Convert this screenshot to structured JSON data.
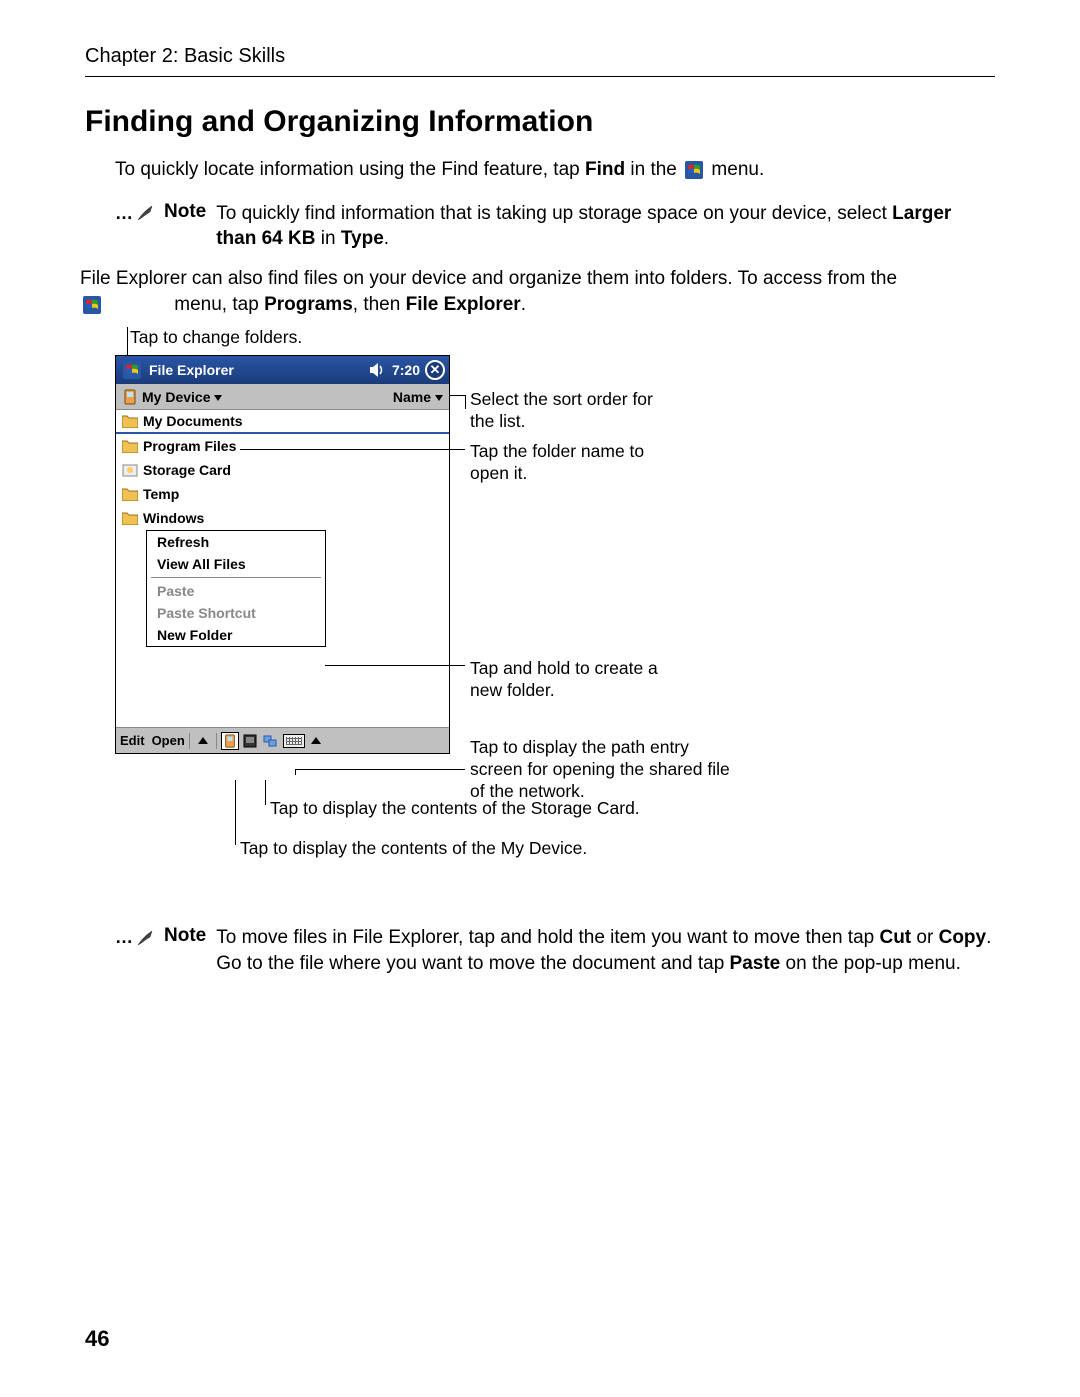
{
  "header": {
    "chapter": "Chapter 2: Basic Skills"
  },
  "title": "Finding and Organizing Information",
  "intro": {
    "pre": "To quickly locate information using the Find feature, tap ",
    "bold1": "Find",
    "mid": " in the ",
    "post": " menu."
  },
  "note1": {
    "label": "Note",
    "text_pre": "To quickly find information that is taking up storage space on your device, select ",
    "bold1": "Larger than 64 KB",
    "mid": " in ",
    "bold2": "Type",
    "post": "."
  },
  "para2": {
    "line1_pre": "File Explorer can also find files on your device and organize them into folders. To access from the",
    "line2_mid": " menu, tap ",
    "bold1": "Programs",
    "comma": ", then ",
    "bold2": "File Explorer",
    "post": "."
  },
  "callouts": {
    "top": "Tap to change folders.",
    "sort": "Select the sort order for the list.",
    "folder": "Tap the folder name to open it.",
    "newfolder": "Tap and hold to create a new folder.",
    "network": "Tap to display the path entry screen for opening the shared file of the network.",
    "storage": "Tap to display the contents of the Storage Card.",
    "mydevice": "Tap to display the contents of the My Device."
  },
  "device": {
    "titlebar": {
      "app": "File Explorer",
      "time": "7:20"
    },
    "toolbar": {
      "location": "My Device",
      "sort": "Name"
    },
    "folders": [
      "My Documents",
      "Program Files",
      "Storage Card",
      "Temp",
      "Windows"
    ],
    "menu": {
      "refresh": "Refresh",
      "viewall": "View All Files",
      "paste": "Paste",
      "paste_shortcut": "Paste Shortcut",
      "newfolder": "New Folder"
    },
    "bottombar": {
      "edit": "Edit",
      "open": "Open"
    }
  },
  "note2": {
    "label": "Note",
    "pre": "To move files in File Explorer, tap and hold the item you want to move then tap ",
    "bold1": "Cut",
    "mid1": " or ",
    "bold2": "Copy",
    "mid2": ". Go to the file where you want to move the document and tap ",
    "bold3": "Paste",
    "post": " on the pop-up menu."
  },
  "page_number": "46"
}
